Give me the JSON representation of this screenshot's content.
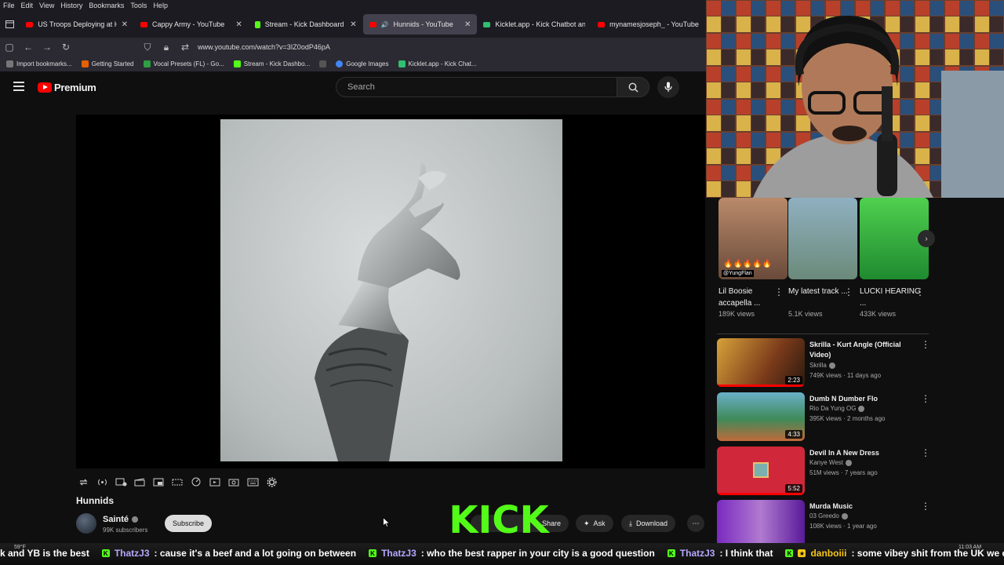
{
  "browser": {
    "menu": [
      "File",
      "Edit",
      "View",
      "History",
      "Bookmarks",
      "Tools",
      "Help"
    ],
    "tabs": [
      {
        "title": "US Troops Deploying at Home |",
        "favicon_color": "#ff0000",
        "active": false
      },
      {
        "title": "Cappy Army - YouTube",
        "favicon_color": "#ff0000",
        "active": false
      },
      {
        "title": "Stream - Kick Dashboard",
        "favicon_color": "#53fc18",
        "active": false
      },
      {
        "title": "Hunnids - YouTube",
        "favicon_color": "#ff0000",
        "active": true
      },
      {
        "title": "Kicklet.app - Kick Chatbot and C",
        "favicon_color": "#2fbf71",
        "active": false
      },
      {
        "title": "mynamesjoseph_ - YouTube",
        "favicon_color": "#ff0000",
        "active": false
      }
    ],
    "url": "www.youtube.com/watch?v=3IZ0odP46pA",
    "bookmarks": [
      "Import bookmarks...",
      "Getting Started",
      "Vocal Presets (FL) - Go...",
      "Stream - Kick Dashbo...",
      "",
      "Google Images",
      "Kicklet.app - Kick Chat..."
    ]
  },
  "youtube": {
    "logo_text": "Premium",
    "search_placeholder": "Search",
    "video": {
      "title": "Hunnids",
      "channel": "Sainté",
      "subscribers": "99K subscribers",
      "subscribe_label": "Subscribe",
      "share_label": "Share",
      "ask_label": "Ask",
      "download_label": "Download"
    },
    "shorts": [
      {
        "title": "Lil Boosie accapella ...",
        "views": "189K views",
        "overlay": "@YungFlan"
      },
      {
        "title": "My latest track ...",
        "views": "5.1K views"
      },
      {
        "title": "LUCKI HEARING ...",
        "views": "433K views"
      }
    ],
    "recommendations": [
      {
        "title": "Skrilla - Kurt Angle (Official Video)",
        "channel": "Skrilla",
        "meta": "749K views · 11 days ago",
        "duration": "2:23",
        "progress": 1.0
      },
      {
        "title": "Dumb N Dumber Flo",
        "channel": "Rio Da Yung OG",
        "meta": "395K views · 2 months ago",
        "duration": "4:33",
        "progress": 0
      },
      {
        "title": "Devil In A New Dress",
        "channel": "Kanye West",
        "meta": "51M views · 7 years ago",
        "duration": "5:52",
        "progress": 1.0
      },
      {
        "title": "Murda Music",
        "channel": "03 Greedo",
        "meta": "108K views · 1 year ago",
        "duration": "",
        "progress": 0
      }
    ]
  },
  "overlay": {
    "kick_logo": "KICK",
    "chat": [
      {
        "user": "",
        "message": "k and YB is the best"
      },
      {
        "user": "ThatzJ3",
        "message": ": cause it's a beef and a lot going on between"
      },
      {
        "user": "ThatzJ3",
        "message": ": who the best rapper in your city is a good question"
      },
      {
        "user": "ThatzJ3",
        "message": ": I think that"
      },
      {
        "user": "danboiii",
        "message": ": some vibey shit from the UK we can do this shit to"
      }
    ],
    "weather": "59°F",
    "time": "11:03 AM"
  },
  "colors": {
    "youtube_red": "#ff0000",
    "kick_green": "#53fc18"
  }
}
